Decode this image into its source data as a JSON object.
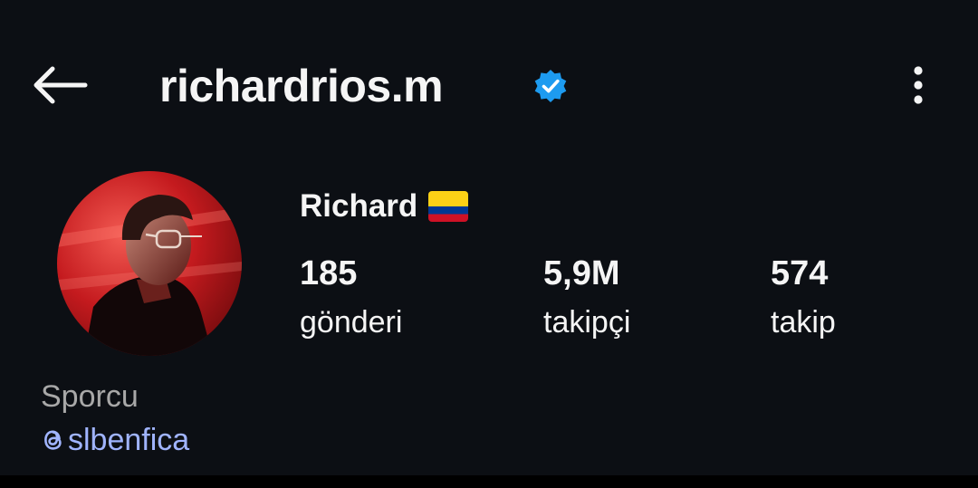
{
  "header": {
    "username": "richardrios.m",
    "verified_icon": "verified-badge-icon",
    "back_icon": "arrow-left-icon",
    "more_icon": "more-vertical-icon"
  },
  "profile": {
    "full_name": "Richard",
    "name_emoji": "colombia-flag-icon",
    "avatar_icon": "profile-photo",
    "stats": [
      {
        "value": "185",
        "label": "gönderi"
      },
      {
        "value": "5,9M",
        "label": "takipçi"
      },
      {
        "value": "574",
        "label": "takip"
      }
    ],
    "category": "Sporcu",
    "threads_handle": "slbenfica",
    "threads_icon": "threads-icon"
  },
  "colors": {
    "background": "#0c0f14",
    "text": "#f5f5f5",
    "secondary_text": "#a8a8a8",
    "link": "#a0b4ff",
    "verified": "#1d9bf0"
  }
}
